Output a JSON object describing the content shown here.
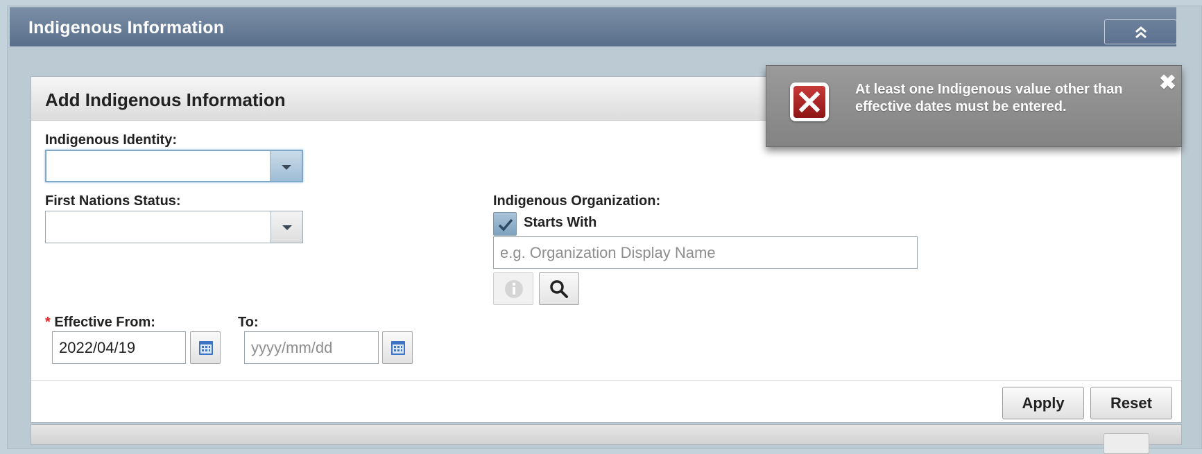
{
  "panel": {
    "title": "Indigenous Information",
    "collapse_icon": "double-chevron-up-icon"
  },
  "form": {
    "title": "Add Indigenous Information",
    "identity": {
      "label": "Indigenous Identity:",
      "value": ""
    },
    "first_nations": {
      "label": "First Nations Status:",
      "value": ""
    },
    "organization": {
      "label": "Indigenous Organization:",
      "starts_with_label": "Starts With",
      "starts_with_checked": true,
      "placeholder": "e.g. Organization Display Name",
      "value": ""
    },
    "effective_from": {
      "required_mark": "*",
      "label": "Effective From:",
      "value": "2022/04/19"
    },
    "to": {
      "label": "To:",
      "placeholder": "yyyy/mm/dd",
      "value": ""
    },
    "apply_label": "Apply",
    "reset_label": "Reset"
  },
  "toast": {
    "message": "At least one Indigenous value other than effective dates must be entered.",
    "close_glyph": "✖",
    "icon": "error-x-icon"
  },
  "colors": {
    "header_bg": "#5a6f8a",
    "error_red": "#b02020",
    "toast_bg": "#8c8c8c"
  }
}
